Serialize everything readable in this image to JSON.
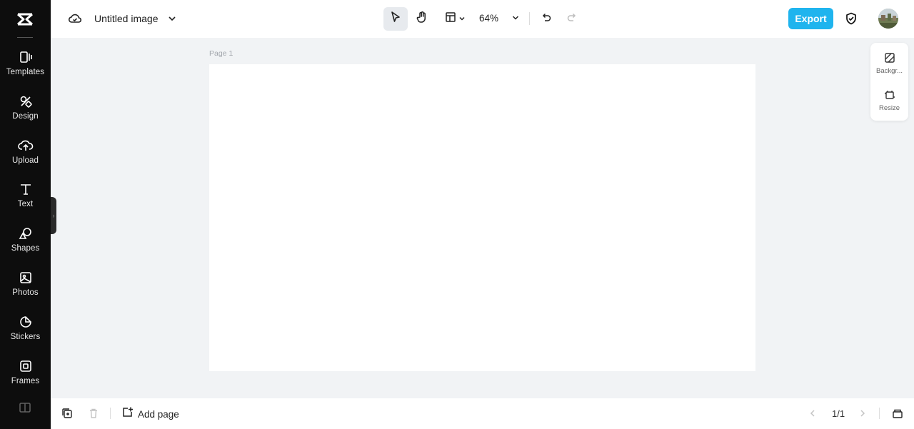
{
  "app": {
    "accent_color": "#1fb4ee",
    "sidebar_bg": "#0d0d0d"
  },
  "sidebar": {
    "logo_icon": "capcut-logo-icon",
    "items": [
      {
        "label": "Templates",
        "icon": "templates-icon"
      },
      {
        "label": "Design",
        "icon": "design-icon"
      },
      {
        "label": "Upload",
        "icon": "upload-icon"
      },
      {
        "label": "Text",
        "icon": "text-icon"
      },
      {
        "label": "Shapes",
        "icon": "shapes-icon"
      },
      {
        "label": "Photos",
        "icon": "photos-icon"
      },
      {
        "label": "Stickers",
        "icon": "stickers-icon"
      },
      {
        "label": "Frames",
        "icon": "frames-icon"
      }
    ]
  },
  "topbar": {
    "title": "Untitled image",
    "zoom": "64%",
    "export_label": "Export"
  },
  "canvas": {
    "page_label": "Page 1"
  },
  "right_panel": {
    "items": [
      {
        "label": "Backgr...",
        "icon": "background-icon"
      },
      {
        "label": "Resize",
        "icon": "resize-icon"
      }
    ]
  },
  "bottombar": {
    "add_page_label": "Add page",
    "pager": "1/1"
  }
}
